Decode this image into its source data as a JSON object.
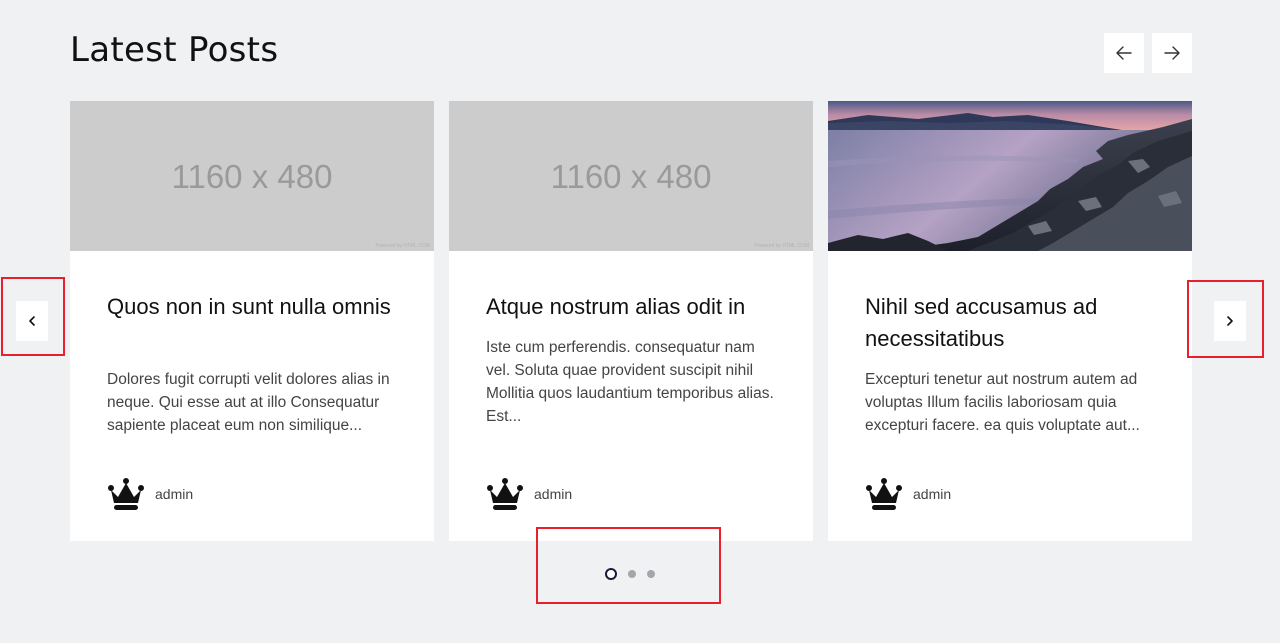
{
  "section": {
    "title": "Latest Posts"
  },
  "posts": [
    {
      "placeholder_text": "1160 x 480",
      "placeholder_credit": "Powered by HTML.COM",
      "title": "Quos non in sunt nulla omnis",
      "excerpt": "Dolores fugit corrupti velit dolores alias in neque. Qui esse aut at illo Consequatur sapiente placeat eum non similique...",
      "author": "admin"
    },
    {
      "placeholder_text": "1160 x 480",
      "placeholder_credit": "Powered by HTML.COM",
      "title": "Atque nostrum alias odit in",
      "excerpt": "Iste cum perferendis. consequatur nam vel. Soluta quae provident suscipit nihil Mollitia quos laudantium temporibus alias. Est...",
      "author": "admin"
    },
    {
      "image": "sunset-lake-rocks-photo",
      "title": "Nihil sed accusamus ad necessitatibus",
      "excerpt": "Excepturi tenetur aut nostrum autem ad voluptas Illum facilis laboriosam quia excepturi facere. ea quis voluptate aut...",
      "author": "admin"
    }
  ],
  "icons": {
    "top_prev": "arrow-left-icon",
    "top_next": "arrow-right-icon",
    "side_prev": "chevron-left-icon",
    "side_next": "chevron-right-icon",
    "avatar": "crown-icon"
  },
  "pagination": {
    "total": 3,
    "active": 1
  },
  "colors": {
    "background": "#f0f1f3",
    "highlight": "#e8202e",
    "dot_active": "#1a1a3a",
    "dot_inactive": "#a3a6ab"
  }
}
